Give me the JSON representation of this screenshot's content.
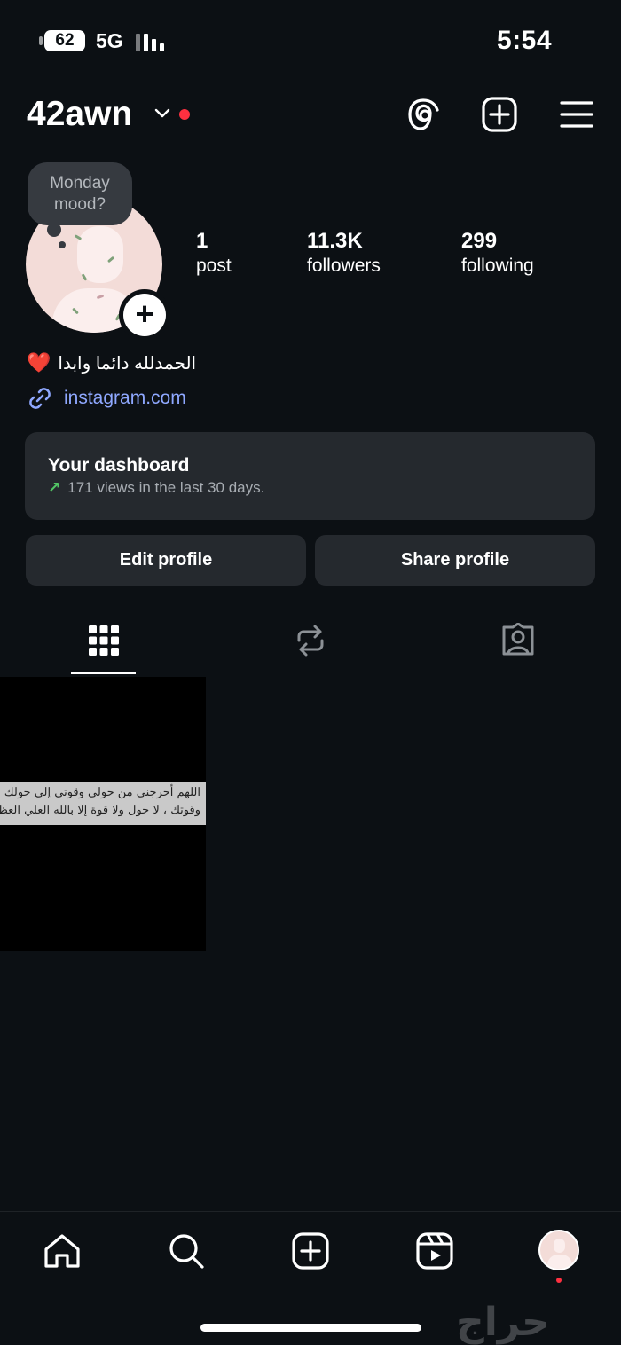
{
  "status_bar": {
    "battery": "62",
    "network": "5G",
    "time": "5:54"
  },
  "header": {
    "username": "42awn"
  },
  "note": {
    "text": "Monday mood?"
  },
  "stats": [
    {
      "value": "1",
      "label": "post"
    },
    {
      "value": "11.3K",
      "label": "followers"
    },
    {
      "value": "299",
      "label": "following"
    }
  ],
  "bio": {
    "text": "الحمدلله دائما وابدا",
    "emoji": "❤️",
    "link": "instagram.com"
  },
  "dashboard": {
    "title": "Your dashboard",
    "subtitle": "171 views in the last 30 days."
  },
  "buttons": {
    "edit": "Edit profile",
    "share": "Share profile"
  },
  "tabs": [
    {
      "name": "grid",
      "icon": "grid-icon",
      "active": true
    },
    {
      "name": "reposts",
      "icon": "repost-icon",
      "active": false
    },
    {
      "name": "tagged",
      "icon": "tagged-icon",
      "active": false
    }
  ],
  "post": {
    "line1": "اللهم أخرجني من حولي وقوتي إلى حولك",
    "line2": "وقوتك ، لا حول ولا قوة إلا بالله العلي العظيم . ."
  },
  "bottom_nav": [
    "home-icon",
    "search-icon",
    "create-icon",
    "reels-icon",
    "profile-avatar"
  ],
  "watermark": "حراج",
  "colors": {
    "background": "#0c1014",
    "surface": "#25292e",
    "link": "#8fa8ff",
    "notification": "#ff3040",
    "trend": "#52c565"
  }
}
